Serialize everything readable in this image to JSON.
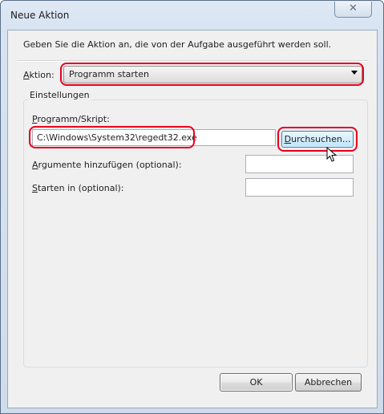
{
  "window": {
    "title": "Neue Aktion",
    "close_glyph": "✕"
  },
  "intro_text": "Geben Sie die Aktion an, die von der Aufgabe ausgeführt werden soll.",
  "action": {
    "label_mnemonic": "A",
    "label_rest": "ktion:",
    "selected": "Programm starten"
  },
  "settings": {
    "group_title": "Einstellungen",
    "program_label_mnemonic": "P",
    "program_label_rest": "rogramm/Skript:",
    "program_value": "C:\\Windows\\System32\\regedt32.exe",
    "browse_mnemonic": "D",
    "browse_rest": "urchsuchen...",
    "args_label_mnemonic": "A",
    "args_label_rest": "rgumente hinzufügen (optional):",
    "args_value": "",
    "start_label_mnemonic": "S",
    "start_label_rest": "tarten in (optional):",
    "start_value": ""
  },
  "buttons": {
    "ok": "OK",
    "cancel": "Abbrechen"
  },
  "colors": {
    "highlight": "#e8001c",
    "browse_hover": "#bee6fd"
  }
}
